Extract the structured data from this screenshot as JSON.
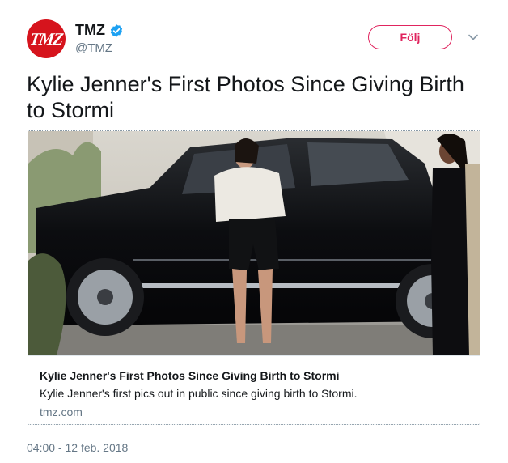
{
  "author": {
    "avatar_text": "TMZ",
    "display_name": "TMZ",
    "handle": "@TMZ",
    "verified": true,
    "avatar_color": "#d6141d",
    "verified_color": "#1da1f2"
  },
  "follow_button": {
    "label": "Följ",
    "color": "#e0245e"
  },
  "menu": {
    "icon": "chevron-down-icon"
  },
  "tweet": {
    "text": "Kylie Jenner's First Photos Since Giving Birth to Stormi"
  },
  "card": {
    "title": "Kylie Jenner's First Photos Since Giving Birth to Stormi",
    "description": "Kylie Jenner's first pics out in public since giving birth to Stormi.",
    "domain": "tmz.com"
  },
  "timestamp": "04:00 - 12 feb. 2018"
}
